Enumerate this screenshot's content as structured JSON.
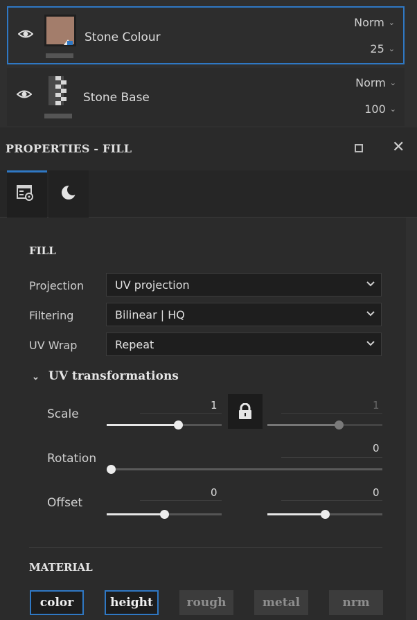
{
  "layers": [
    {
      "name": "Stone Colour",
      "blend": "Norm",
      "opacity": "25",
      "selected": true,
      "thumb_color": "#a37d6b"
    },
    {
      "name": "Stone Base",
      "blend": "Norm",
      "opacity": "100",
      "selected": false
    }
  ],
  "properties": {
    "title": "PROPERTIES - FILL",
    "tabs": [
      {
        "icon": "fill-settings-icon",
        "active": true
      },
      {
        "icon": "material-sphere-icon",
        "active": false
      }
    ]
  },
  "fill": {
    "section_title": "FILL",
    "projection": {
      "label": "Projection",
      "value": "UV projection"
    },
    "filtering": {
      "label": "Filtering",
      "value": "Bilinear | HQ"
    },
    "uv_wrap": {
      "label": "UV Wrap",
      "value": "Repeat"
    }
  },
  "uv_transformations": {
    "title": "UV transformations",
    "scale": {
      "label": "Scale",
      "value_u": "1",
      "value_v": "1",
      "level_u": 0.62,
      "level_v": 0.62,
      "locked": true
    },
    "rotation": {
      "label": "Rotation",
      "value": "0",
      "level": 0.0
    },
    "offset": {
      "label": "Offset",
      "value_u": "0",
      "value_v": "0",
      "level_u": 0.5,
      "level_v": 0.5
    }
  },
  "material": {
    "section_title": "MATERIAL",
    "channels": [
      {
        "label": "color",
        "enabled": true
      },
      {
        "label": "height",
        "enabled": true
      },
      {
        "label": "rough",
        "enabled": false
      },
      {
        "label": "metal",
        "enabled": false
      },
      {
        "label": "nrm",
        "enabled": false
      }
    ]
  },
  "colors": {
    "accent": "#2f78c4",
    "background": "#2b2b2b"
  }
}
